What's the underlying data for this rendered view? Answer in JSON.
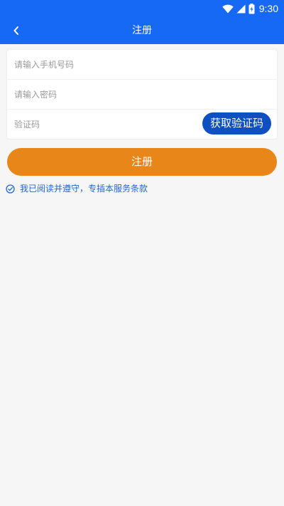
{
  "status_bar": {
    "time": "9:30",
    "icons": [
      "wifi-icon",
      "signal-icon",
      "battery-icon"
    ]
  },
  "app_bar": {
    "title": "注册",
    "back_icon": "chevron-left-icon"
  },
  "form": {
    "phone": {
      "placeholder": "请输入手机号码",
      "value": ""
    },
    "password": {
      "placeholder": "请输入密码",
      "value": ""
    },
    "code": {
      "placeholder": "验证码",
      "value": ""
    },
    "get_code_label": "获取验证码"
  },
  "submit_label": "注册",
  "agreement": {
    "text": "我已阅读并遵守，专插本服务条款",
    "checked": true
  },
  "colors": {
    "primary": "#1669f5",
    "code_button": "#0e4fc1",
    "submit_button": "#e8861a",
    "link": "#1f67dc",
    "background": "#f6f6f6"
  }
}
